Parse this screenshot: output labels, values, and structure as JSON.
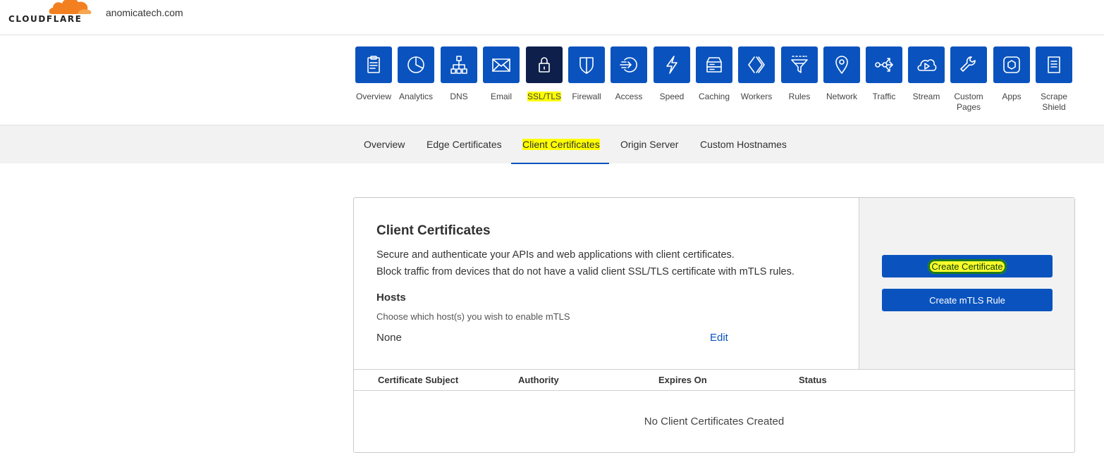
{
  "header": {
    "logo_text": "CLOUDFLARE",
    "domain": "anomicatech.com",
    "brand_color": "#f38020"
  },
  "nav": {
    "accent": "#0a53be",
    "active_color": "#0d1f4a",
    "items": [
      {
        "label": "Overview",
        "icon": "clipboard-icon"
      },
      {
        "label": "Analytics",
        "icon": "pie-chart-icon"
      },
      {
        "label": "DNS",
        "icon": "sitemap-icon"
      },
      {
        "label": "Email",
        "icon": "envelope-icon"
      },
      {
        "label": "SSL/TLS",
        "icon": "lock-icon"
      },
      {
        "label": "Firewall",
        "icon": "shield-icon"
      },
      {
        "label": "Access",
        "icon": "access-icon"
      },
      {
        "label": "Speed",
        "icon": "lightning-icon"
      },
      {
        "label": "Caching",
        "icon": "server-icon"
      },
      {
        "label": "Workers",
        "icon": "code-brackets-icon"
      },
      {
        "label": "Rules",
        "icon": "filter-icon"
      },
      {
        "label": "Network",
        "icon": "location-pin-icon"
      },
      {
        "label": "Traffic",
        "icon": "share-nodes-icon"
      },
      {
        "label": "Stream",
        "icon": "cloud-play-icon"
      },
      {
        "label": "Custom Pages",
        "icon": "wrench-icon"
      },
      {
        "label": "Apps",
        "icon": "hexagon-icon"
      },
      {
        "label": "Scrape Shield",
        "icon": "document-icon"
      }
    ]
  },
  "subnav": {
    "tabs": [
      {
        "label": "Overview"
      },
      {
        "label": "Edge Certificates"
      },
      {
        "label": "Client Certificates"
      },
      {
        "label": "Origin Server"
      },
      {
        "label": "Custom Hostnames"
      }
    ]
  },
  "card": {
    "title": "Client Certificates",
    "desc_line1": "Secure and authenticate your APIs and web applications with client certificates.",
    "desc_line2": "Block traffic from devices that do not have a valid client SSL/TLS certificate with mTLS rules.",
    "hosts_title": "Hosts",
    "hosts_sub": "Choose which host(s) you wish to enable mTLS",
    "hosts_value": "None",
    "edit_label": "Edit",
    "create_certificate_label": "Create Certificate",
    "create_mtls_label": "Create mTLS Rule"
  },
  "table": {
    "columns": [
      "Certificate Subject",
      "Authority",
      "Expires On",
      "Status"
    ],
    "empty_message": "No Client Certificates Created"
  }
}
